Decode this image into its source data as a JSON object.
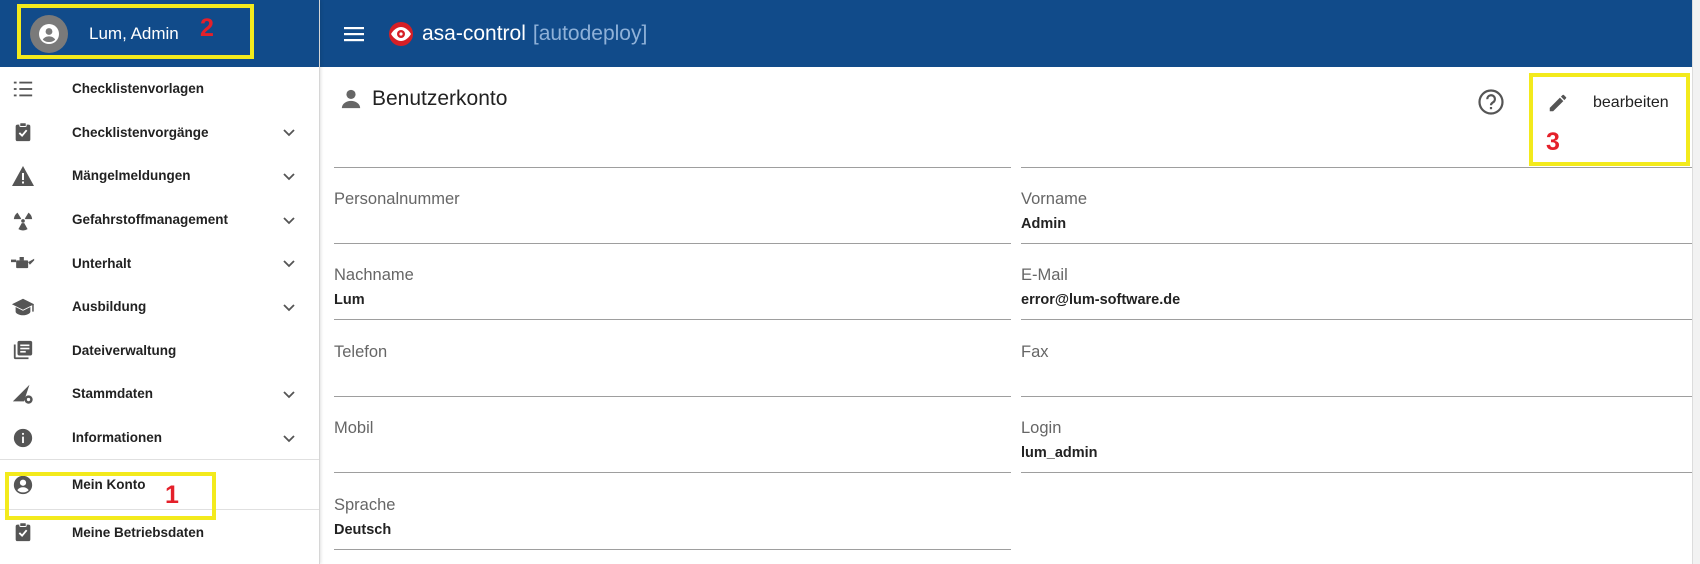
{
  "user": {
    "name": "Lum, Admin"
  },
  "app": {
    "title": "asa-control",
    "env": "[autodeploy]"
  },
  "sidebar": {
    "items": [
      {
        "label": "Checklistenvorlagen",
        "icon": "list-numbered-icon",
        "expandable": false
      },
      {
        "label": "Checklistenvorgänge",
        "icon": "clipboard-check-icon",
        "expandable": true
      },
      {
        "label": "Mängelmeldungen",
        "icon": "warning-icon",
        "expandable": true
      },
      {
        "label": "Gefahrstoffmanagement",
        "icon": "radiation-icon",
        "expandable": true
      },
      {
        "label": "Unterhalt",
        "icon": "oil-can-icon",
        "expandable": true
      },
      {
        "label": "Ausbildung",
        "icon": "graduation-cap-icon",
        "expandable": true
      },
      {
        "label": "Dateiverwaltung",
        "icon": "library-books-icon",
        "expandable": false
      },
      {
        "label": "Stammdaten",
        "icon": "settings-triangle-icon",
        "expandable": true
      },
      {
        "label": "Informationen",
        "icon": "info-icon",
        "expandable": true
      },
      {
        "label": "Mein Konto",
        "icon": "account-circle-icon",
        "expandable": false
      },
      {
        "label": "Meine Betriebsdaten",
        "icon": "clipboard-check-icon",
        "expandable": false
      }
    ]
  },
  "page": {
    "title": "Benutzerkonto",
    "edit_label": "bearbeiten"
  },
  "fields": {
    "personalnummer": {
      "label": "Personalnummer",
      "value": ""
    },
    "vorname": {
      "label": "Vorname",
      "value": "Admin"
    },
    "nachname": {
      "label": "Nachname",
      "value": "Lum"
    },
    "email": {
      "label": "E-Mail",
      "value": "error@lum-software.de"
    },
    "telefon": {
      "label": "Telefon",
      "value": ""
    },
    "fax": {
      "label": "Fax",
      "value": ""
    },
    "mobil": {
      "label": "Mobil",
      "value": ""
    },
    "login": {
      "label": "Login",
      "value": "lum_admin"
    },
    "sprache": {
      "label": "Sprache",
      "value": "Deutsch"
    }
  },
  "annotations": {
    "n1": "1",
    "n2": "2",
    "n3": "3"
  },
  "colors": {
    "header": "#114b8a",
    "highlight": "#f3ea1c",
    "annotation": "#e4202a"
  }
}
